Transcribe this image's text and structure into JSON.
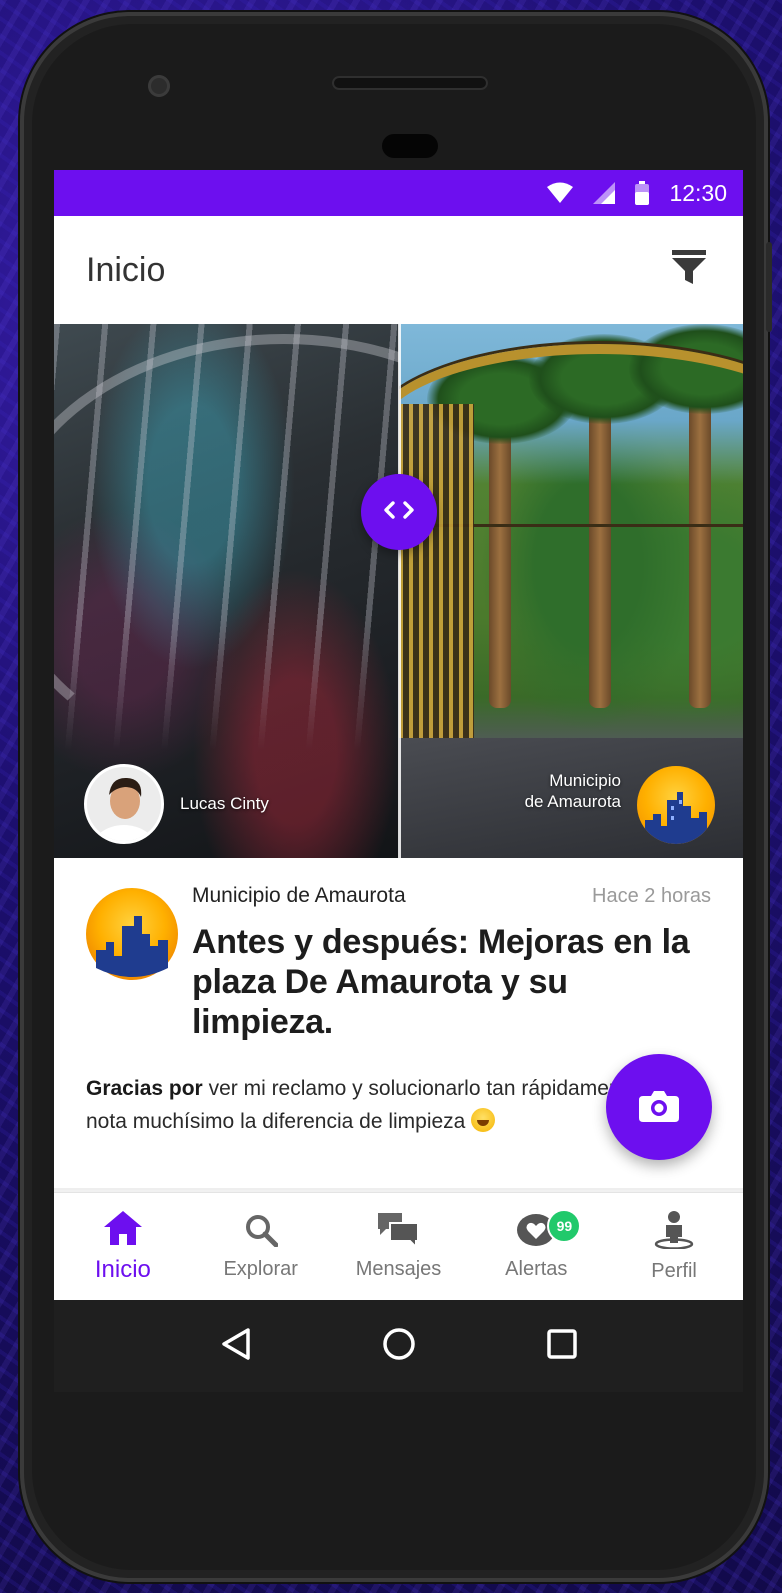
{
  "status_bar": {
    "time": "12:30",
    "icons": [
      "wifi-icon",
      "signal-icon",
      "battery-icon"
    ]
  },
  "app_bar": {
    "title": "Inicio",
    "filter_icon": "filter-icon"
  },
  "comparison": {
    "before_author": "Lucas Cinty",
    "after_author_line1": "Municipio",
    "after_author_line2": "de Amaurota",
    "swap_icon": "code-arrows-icon"
  },
  "post": {
    "author": "Municipio de Amaurota",
    "time": "Hace 2 horas",
    "title": "Antes y después: Mejoras en la plaza De Amaurota y su limpieza.",
    "body_bold": "Gracias por",
    "body_text": " ver mi reclamo y solucionarlo tan rápidamente! Se nota muchísimo la diferencia de limpieza ",
    "emoji": "grinning-face-emoji"
  },
  "fab": {
    "icon": "camera-icon"
  },
  "bottom_nav": {
    "items": [
      {
        "label": "Inicio",
        "icon": "home-icon",
        "active": true
      },
      {
        "label": "Explorar",
        "icon": "search-icon",
        "active": false
      },
      {
        "label": "Mensajes",
        "icon": "chat-icon",
        "active": false
      },
      {
        "label": "Alertas",
        "icon": "heart-bubble-icon",
        "active": false,
        "badge": "99"
      },
      {
        "label": "Perfil",
        "icon": "person-icon",
        "active": false
      }
    ]
  },
  "android_nav": {
    "icons": [
      "back-icon",
      "home-circle-icon",
      "recents-icon"
    ]
  },
  "colors": {
    "accent": "#6d0fef",
    "badge": "#21c96b",
    "city_avatar": "#ffb000"
  }
}
